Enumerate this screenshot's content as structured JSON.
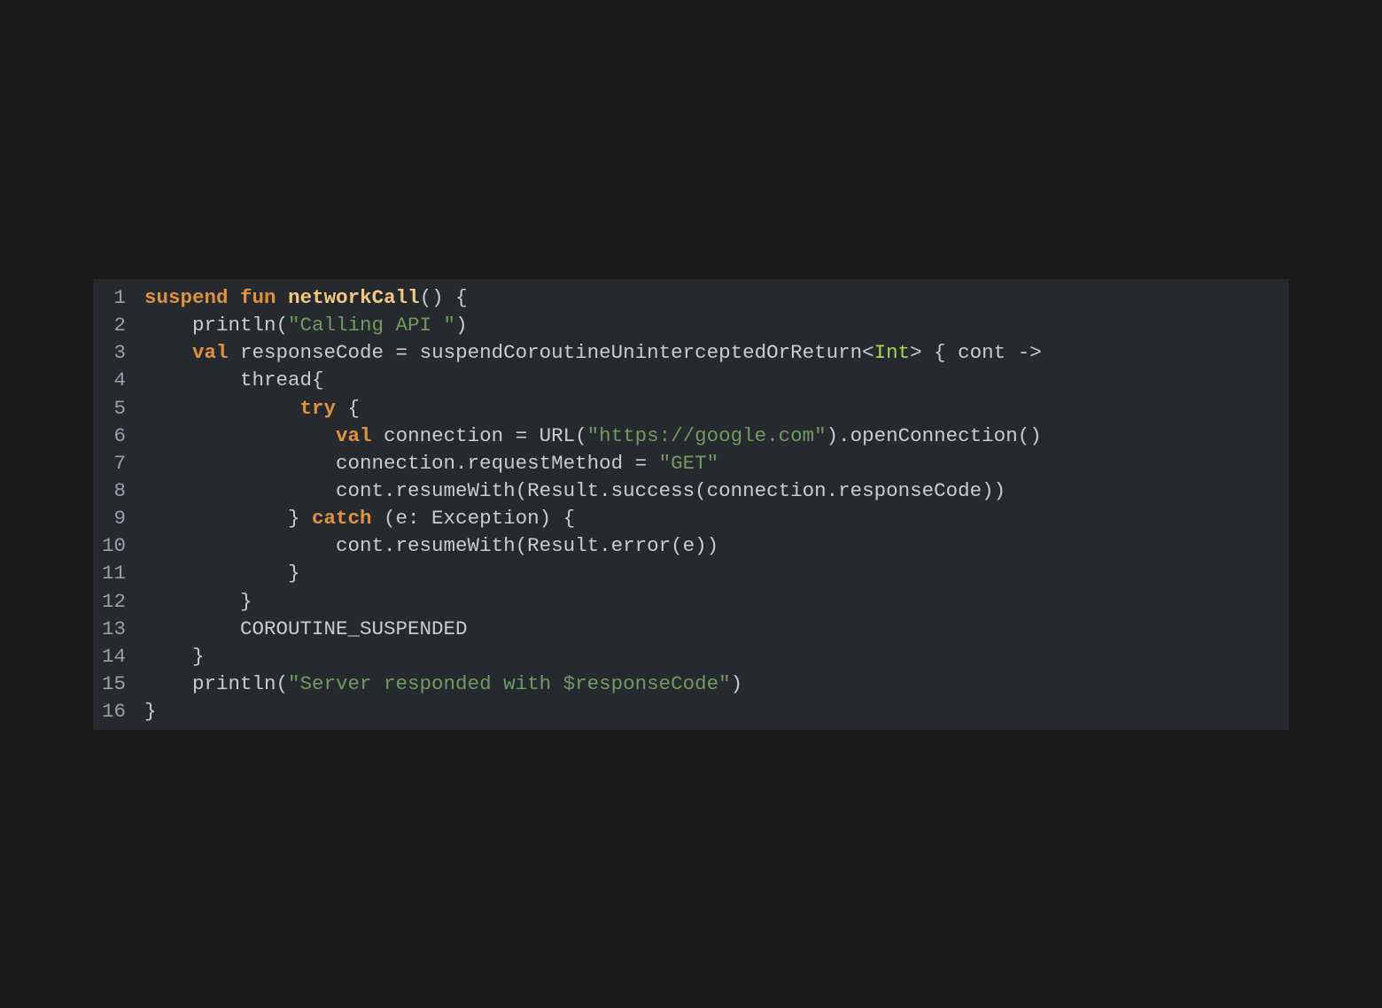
{
  "colors": {
    "background": "#1a1a1a",
    "panel": "#262a2e",
    "line_number": "#9aa0a6",
    "default_text": "#c9ccd0",
    "keyword": "#e0913e",
    "function_name": "#f3c980",
    "string": "#6f9a63",
    "type": "#a6d84a"
  },
  "lines": [
    {
      "n": "1",
      "tokens": [
        {
          "t": "suspend",
          "k": "kw"
        },
        {
          "t": " "
        },
        {
          "t": "fun",
          "k": "kw"
        },
        {
          "t": " "
        },
        {
          "t": "networkCall",
          "k": "fn"
        },
        {
          "t": "() {"
        }
      ]
    },
    {
      "n": "2",
      "tokens": [
        {
          "t": "    println("
        },
        {
          "t": "\"Calling API \"",
          "k": "str"
        },
        {
          "t": ")"
        }
      ]
    },
    {
      "n": "3",
      "tokens": [
        {
          "t": "    "
        },
        {
          "t": "val",
          "k": "kw"
        },
        {
          "t": " responseCode = suspendCoroutineUninterceptedOrReturn<"
        },
        {
          "t": "Int",
          "k": "typ"
        },
        {
          "t": "> { cont ->"
        }
      ]
    },
    {
      "n": "4",
      "tokens": [
        {
          "t": "        thread{"
        }
      ]
    },
    {
      "n": "5",
      "tokens": [
        {
          "t": "             "
        },
        {
          "t": "try",
          "k": "kw"
        },
        {
          "t": " {"
        }
      ]
    },
    {
      "n": "6",
      "tokens": [
        {
          "t": "                "
        },
        {
          "t": "val",
          "k": "kw"
        },
        {
          "t": " connection = URL("
        },
        {
          "t": "\"https://google.com\"",
          "k": "str"
        },
        {
          "t": ").openConnection()"
        }
      ]
    },
    {
      "n": "7",
      "tokens": [
        {
          "t": "                connection.requestMethod = "
        },
        {
          "t": "\"GET\"",
          "k": "str"
        }
      ]
    },
    {
      "n": "8",
      "tokens": [
        {
          "t": "                cont.resumeWith(Result.success(connection.responseCode))"
        }
      ]
    },
    {
      "n": "9",
      "tokens": [
        {
          "t": "            } "
        },
        {
          "t": "catch",
          "k": "kw"
        },
        {
          "t": " (e: Exception) {"
        }
      ]
    },
    {
      "n": "10",
      "tokens": [
        {
          "t": "                cont.resumeWith(Result.error(e))"
        }
      ]
    },
    {
      "n": "11",
      "tokens": [
        {
          "t": "            }"
        }
      ]
    },
    {
      "n": "12",
      "tokens": [
        {
          "t": "        }"
        }
      ]
    },
    {
      "n": "13",
      "tokens": [
        {
          "t": "        COROUTINE_SUSPENDED"
        }
      ]
    },
    {
      "n": "14",
      "tokens": [
        {
          "t": "    }"
        }
      ]
    },
    {
      "n": "15",
      "tokens": [
        {
          "t": "    println("
        },
        {
          "t": "\"Server responded with $responseCode\"",
          "k": "str"
        },
        {
          "t": ")"
        }
      ]
    },
    {
      "n": "16",
      "tokens": [
        {
          "t": "}"
        }
      ]
    }
  ]
}
